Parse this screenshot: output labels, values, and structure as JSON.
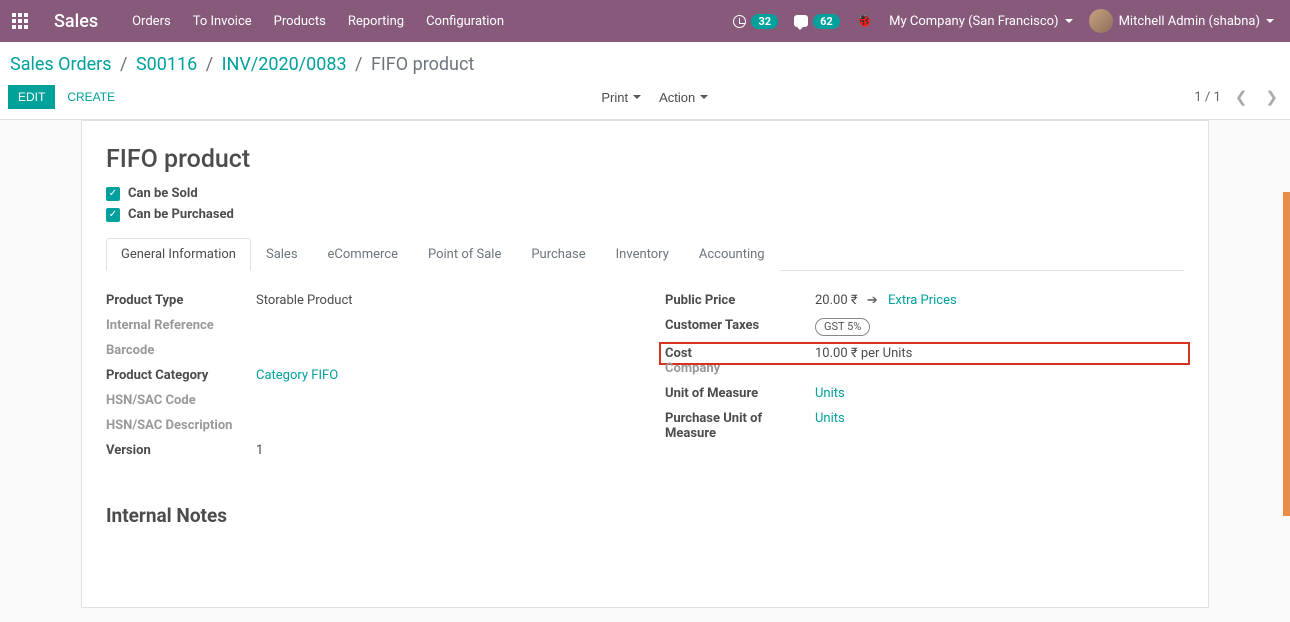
{
  "header": {
    "brand": "Sales",
    "nav": [
      "Orders",
      "To Invoice",
      "Products",
      "Reporting",
      "Configuration"
    ],
    "activity_count": "32",
    "message_count": "62",
    "company": "My Company (San Francisco)",
    "user": "Mitchell Admin (shabna)"
  },
  "breadcrumbs": {
    "items": [
      "Sales Orders",
      "S00116",
      "INV/2020/0083"
    ],
    "current": "FIFO product"
  },
  "controls": {
    "edit": "EDIT",
    "create": "CREATE",
    "print": "Print",
    "action": "Action",
    "pager": "1 / 1"
  },
  "product": {
    "title": "FIFO product",
    "can_be_sold": "Can be Sold",
    "can_be_purchased": "Can be Purchased"
  },
  "tabs": [
    "General Information",
    "Sales",
    "eCommerce",
    "Point of Sale",
    "Purchase",
    "Inventory",
    "Accounting"
  ],
  "fields_left": {
    "product_type": {
      "label": "Product Type",
      "value": "Storable Product"
    },
    "internal_reference": {
      "label": "Internal Reference",
      "value": ""
    },
    "barcode": {
      "label": "Barcode",
      "value": ""
    },
    "product_category": {
      "label": "Product Category",
      "value": "Category FIFO"
    },
    "hsn_code": {
      "label": "HSN/SAC Code",
      "value": ""
    },
    "hsn_desc": {
      "label": "HSN/SAC Description",
      "value": ""
    },
    "version": {
      "label": "Version",
      "value": "1"
    }
  },
  "fields_right": {
    "public_price": {
      "label": "Public Price",
      "value": "20.00 ₹",
      "extra": "Extra Prices"
    },
    "customer_taxes": {
      "label": "Customer Taxes",
      "value": "GST 5%"
    },
    "cost": {
      "label": "Cost",
      "value": "10.00 ₹ per Units"
    },
    "company": {
      "label": "Company",
      "value": ""
    },
    "uom": {
      "label": "Unit of Measure",
      "value": "Units"
    },
    "purchase_uom": {
      "label": "Purchase Unit of Measure",
      "value": "Units"
    }
  },
  "internal_notes": {
    "title": "Internal Notes"
  }
}
